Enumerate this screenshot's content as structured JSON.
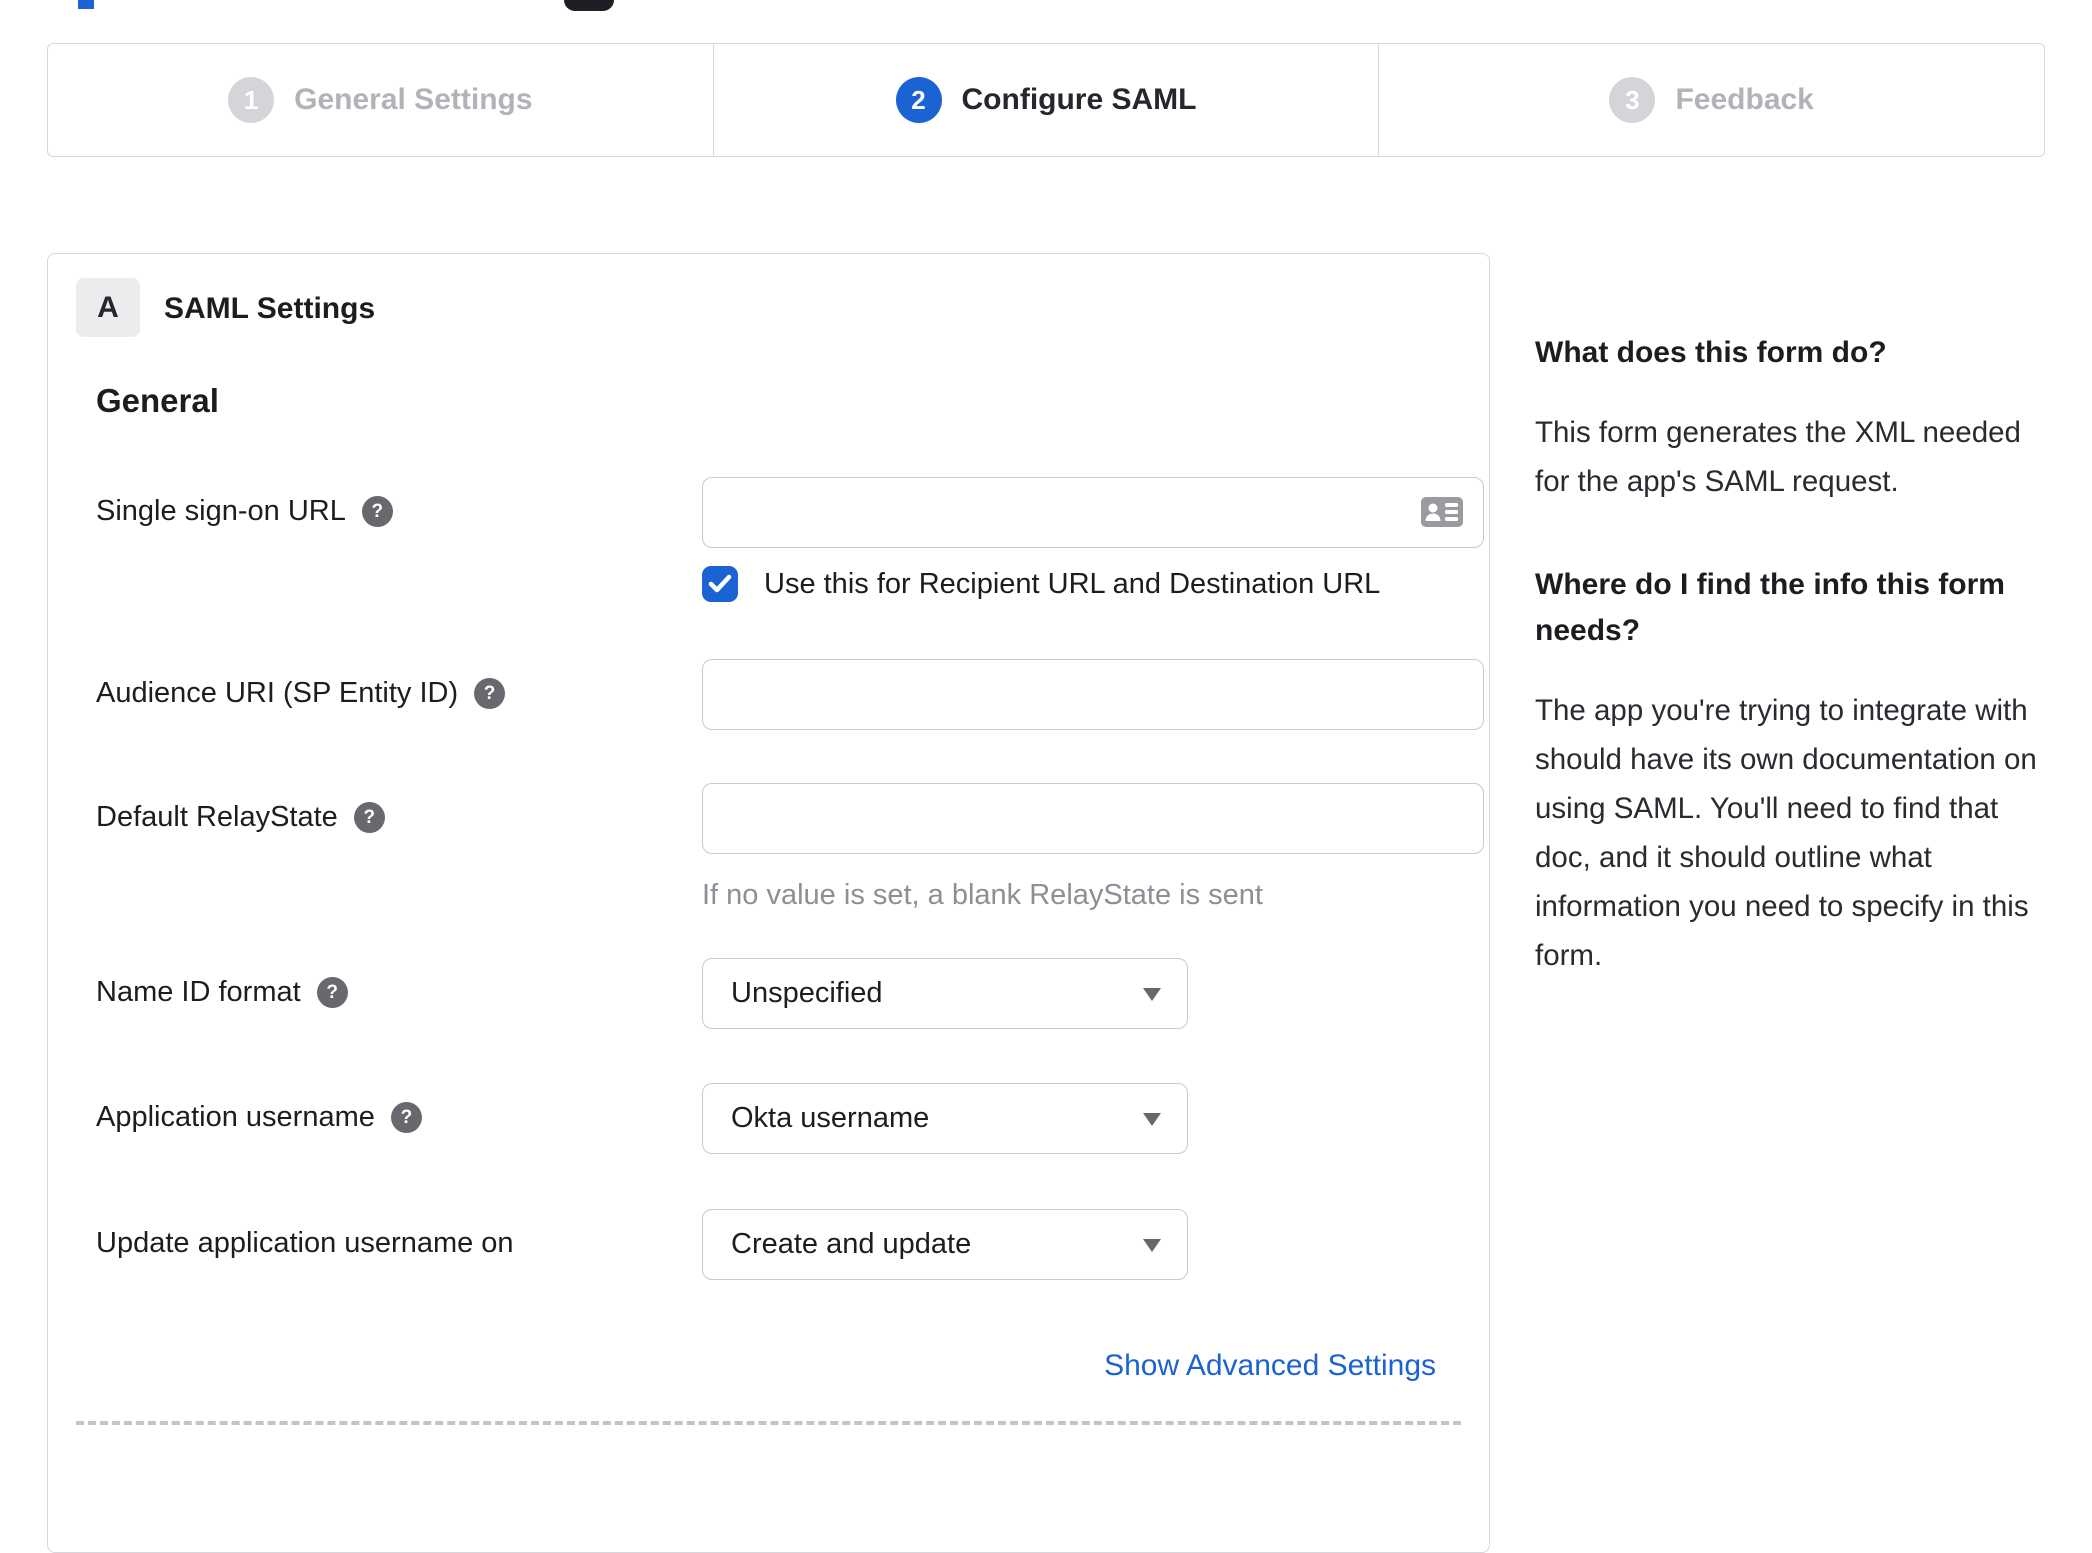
{
  "colors": {
    "accent_blue": "#1b63d2",
    "inactive_gray": "#b2b2b8",
    "border_gray": "#d8d8dc",
    "text_dark": "#1d1d21",
    "hint_gray": "#8e8e96"
  },
  "icons": {
    "help": "question-mark-circle",
    "sso_input": "contact-card",
    "select_caret": "triangle-down",
    "checkbox_check": "checkmark"
  },
  "stepper": {
    "steps": [
      {
        "number": "1",
        "label": "General Settings",
        "state": "inactive"
      },
      {
        "number": "2",
        "label": "Configure SAML",
        "state": "active"
      },
      {
        "number": "3",
        "label": "Feedback",
        "state": "inactive"
      }
    ]
  },
  "panel": {
    "section_badge": "A",
    "section_title": "SAML Settings",
    "group_heading": "General",
    "fields": [
      {
        "type": "text",
        "label": "Single sign-on URL",
        "has_help": true,
        "value": "",
        "checkbox_checked": true,
        "checkbox_label": "Use this for Recipient URL and Destination URL"
      },
      {
        "type": "text",
        "label": "Audience URI (SP Entity ID)",
        "has_help": true,
        "value": ""
      },
      {
        "type": "text",
        "label": "Default RelayState",
        "has_help": true,
        "value": "",
        "hint": "If no value is set, a blank RelayState is sent"
      },
      {
        "type": "select",
        "label": "Name ID format",
        "has_help": true,
        "value": "Unspecified"
      },
      {
        "type": "select",
        "label": "Application username",
        "has_help": true,
        "value": "Okta username"
      },
      {
        "type": "select",
        "label": "Update application username on",
        "has_help": false,
        "value": "Create and update"
      }
    ],
    "advanced_link": "Show Advanced Settings"
  },
  "sidebar": {
    "q1": "What does this form do?",
    "a1": "This form generates the XML needed for the app's SAML request.",
    "q2": "Where do I find the info this form needs?",
    "a2": "The app you're trying to integrate with should have its own documentation on using SAML. You'll need to find that doc, and it should outline what information you need to specify in this form."
  }
}
